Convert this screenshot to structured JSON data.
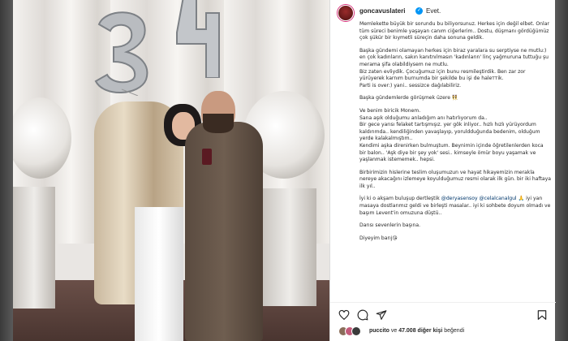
{
  "post": {
    "username": "goncavuslateri",
    "header_text": "Evet."
  },
  "caption": {
    "p1": "Memlekette büyük bir sorundu bu biliyorsunuz. Herkes için değil elbet. Onlar tüm süreci benimle yaşayan canım ciğerlerim.. Dostu, düşmanı gördüğümüz çok şükür bir kıymetli süreçin daha sonuna geldik.",
    "p2": "Başka gündemi olamayan herkes için biraz yaralara su serptiyse ne mutlu:) en çok kadınların, sakın kanıtnılmasın 'kadınların' linç yağmuruna tuttuğu şu merama şifa olabildiysem ne mutlu.",
    "p3": "Biz zaten evliydik. Çocuğumuz için bunu resmileştirdik. Ben zar zor yürüyerek karnım burnumda bir şekilde bu işi de haleттik.",
    "p4": "Parti is over:) yani.. sessizce dağılabiliriz.",
    "p5": "Başka gündemlerde görüşmek üzere 👯",
    "p6": "Ve benim biricik Monem.",
    "p7": "Sana aşık olduğumu anladığım anı hatırlıyorum da..",
    "p8": "Bir gece yarısı felaket tartışmışız. yer gök inliyor.. hızlı hızlı yürüyordum kaldırımda.. kendiliğinden yavaşlayıp, yoruldduğunda bedenim, olduğum yerde kalakalmıştım..",
    "p9": "Kendimi aşka direnirken bulmuştum. Beynimin içinde öğretilenlerden koca bir balon.. 'Aşk diye bir şey yok' sesi.. kimseyle ömür boyu yaşamak ve yaşlanmak istememek.. hepsi.",
    "p10": "Birbirimizin hislerine teslim oluşumuzun ve hayat hikayemizin merakla nereye akacağını izlemeye koyulduğumuz resmi olarak ilk gün. bir iki haftaya ilk yıl..",
    "p11a": "İyi ki o akşam buluşup dertleştik ",
    "mention1": "@deryasensoy",
    "mention2": "@celalcanalgul",
    "p11b": "🙏 iyi yan masaya dostlarımız geldi ve birleşti masalar.. iyi ki sohbete doyum olmadı ve başım Levent'in omuzuna düştü..",
    "p12": "Darısı sevenlerin başına.",
    "p13": "Diyeyim barıј😘"
  },
  "likes": {
    "liker": "puccito",
    "connector": " ve ",
    "count": "47.008 diğer kişi",
    "suffix": " beğendi"
  },
  "icons": [
    "heart-icon",
    "comment-icon",
    "share-icon",
    "bookmark-icon",
    "verified-icon"
  ],
  "colors": {
    "verified": "#0095f6",
    "mention": "#00376b",
    "text": "#262626"
  }
}
